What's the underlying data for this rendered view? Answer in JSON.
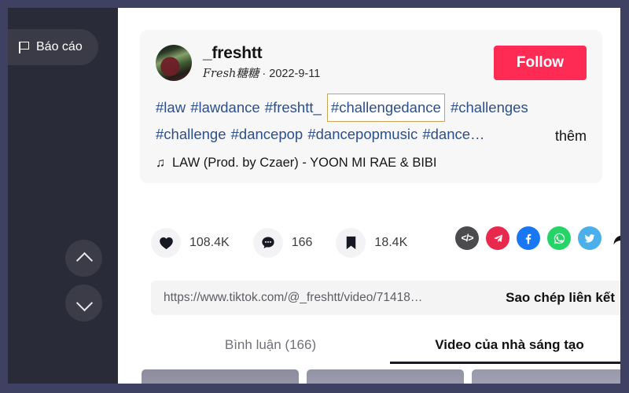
{
  "window": {
    "frame_bg": "#3f4162",
    "panel_bg": "#2a2b38",
    "content_bg": "#ffffff"
  },
  "video_panel": {
    "report_label": "Báo cáo",
    "report_icon": "flag-icon",
    "nav_up_icon": "chevron-up-icon",
    "nav_down_icon": "chevron-down-icon"
  },
  "post": {
    "username": "_freshtt",
    "nickname": "Fresh糖糖",
    "separator": " · ",
    "date": "2022-9-11",
    "follow_label": "Follow",
    "follow_color": "#fe2c55",
    "avatar_icon": "avatar",
    "hashtags_before": "#law #lawdance #freshtt_ ",
    "hashtag_highlighted": "#challengedance",
    "hashtags_after": " #challenges #challenge #dancepop #dancepopmusic #dance…",
    "highlight_border_color": "#c9a455",
    "more_label": "thêm",
    "music_note_icon": "music-note-icon",
    "music_note_glyph": "♫",
    "music_title": "LAW (Prod. by Czaer) - YOON MI RAE & BIBI"
  },
  "actions": {
    "like": {
      "icon": "heart-icon",
      "count": "108.4K"
    },
    "comment": {
      "icon": "comment-bubble-icon",
      "count": "166"
    },
    "bookmark": {
      "icon": "bookmark-icon",
      "count": "18.4K"
    },
    "share": [
      {
        "name": "embed-code-icon",
        "glyph": "</>",
        "color": "#4b4b4e"
      },
      {
        "name": "telegram-icon",
        "glyph": "➤",
        "color": "#e8284c"
      },
      {
        "name": "facebook-icon",
        "glyph": "f",
        "color": "#1977f3"
      },
      {
        "name": "whatsapp-icon",
        "glyph": "✆",
        "color": "#25d366"
      },
      {
        "name": "twitter-icon",
        "glyph": "🐦",
        "color": "#4aafeb"
      },
      {
        "name": "forward-arrow-icon",
        "glyph": "➤",
        "color": "#111111"
      }
    ]
  },
  "link": {
    "url": "https://www.tiktok.com/@_freshtt/video/71418…",
    "copy_label": "Sao chép liên kết"
  },
  "tabs": [
    {
      "label": "Bình luận (166)",
      "active": false
    },
    {
      "label": "Video của nhà sáng tạo",
      "active": true
    }
  ],
  "thumbnails": [
    {
      "name": "video-thumbnail-1"
    },
    {
      "name": "video-thumbnail-2"
    },
    {
      "name": "video-thumbnail-3"
    }
  ]
}
